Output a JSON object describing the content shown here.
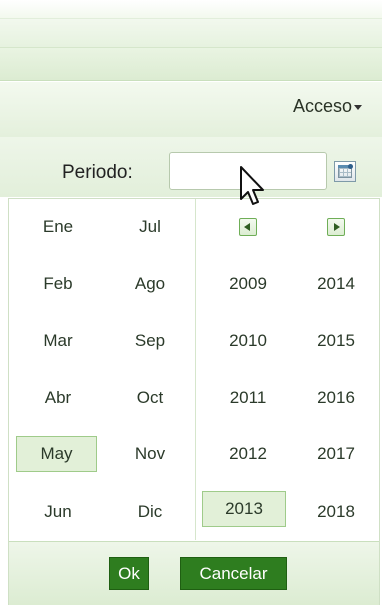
{
  "header": {
    "menu_label": "Acceso"
  },
  "filter": {
    "label": "Periodo:",
    "value": "",
    "calendar_icon": "calendar-icon"
  },
  "picker": {
    "months": [
      "Ene",
      "Jul",
      "Feb",
      "Ago",
      "Mar",
      "Sep",
      "Abr",
      "Oct",
      "May",
      "Nov",
      "Jun",
      "Dic"
    ],
    "selected_month": "May",
    "years": [
      "2009",
      "2014",
      "2010",
      "2015",
      "2011",
      "2016",
      "2012",
      "2017",
      "2013",
      "2018"
    ],
    "selected_year": "2013",
    "prev_icon": "arrow-left-icon",
    "next_icon": "arrow-right-icon",
    "ok_label": "Ok",
    "cancel_label": "Cancelar"
  },
  "colors": {
    "accent": "#2e7d1f",
    "selection_bg": "#e2f0d8",
    "selection_border": "#9fcb8a"
  }
}
